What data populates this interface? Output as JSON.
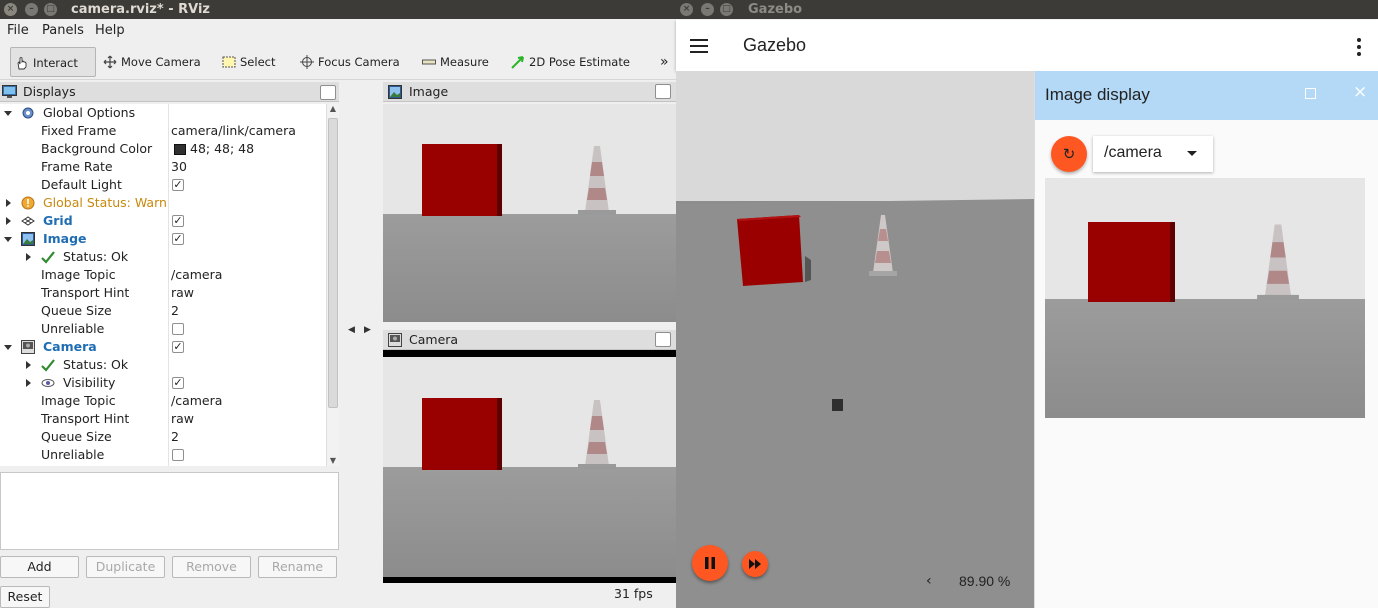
{
  "rviz": {
    "window_title": "camera.rviz* - RViz",
    "menu": [
      "File",
      "Panels",
      "Help"
    ],
    "toolbar": [
      "Interact",
      "Move Camera",
      "Select",
      "Focus Camera",
      "Measure",
      "2D Pose Estimate"
    ],
    "toolbar_overflow": "»",
    "displays_title": "Displays",
    "tree": {
      "global_options": "Global Options",
      "fixed_frame_label": "Fixed Frame",
      "fixed_frame_value": "camera/link/camera",
      "background_color_label": "Background Color",
      "background_color_value": "48; 48; 48",
      "frame_rate_label": "Frame Rate",
      "frame_rate_value": "30",
      "default_light_label": "Default Light",
      "global_status": "Global Status: Warn",
      "grid": "Grid",
      "image": "Image",
      "image_status": "Status: Ok",
      "image_topic_label": "Image Topic",
      "image_topic_value": "/camera",
      "transport_hint_label": "Transport Hint",
      "transport_hint_value": "raw",
      "queue_size_label": "Queue Size",
      "queue_size_value": "2",
      "unreliable_label": "Unreliable",
      "camera": "Camera",
      "camera_status": "Status: Ok",
      "visibility": "Visibility",
      "cam_image_topic_label": "Image Topic",
      "cam_image_topic_value": "/camera",
      "cam_transport_hint_label": "Transport Hint",
      "cam_transport_hint_value": "raw",
      "cam_queue_size_label": "Queue Size",
      "cam_queue_size_value": "2",
      "cam_unreliable_label": "Unreliable"
    },
    "buttons": {
      "add": "Add",
      "duplicate": "Duplicate",
      "remove": "Remove",
      "rename": "Rename",
      "reset": "Reset"
    },
    "image_panel_title": "Image",
    "camera_panel_title": "Camera",
    "fps": "31 fps",
    "colors": {
      "background_swatch": "#303030",
      "status_blue": "#1f6db3",
      "warn": "#c8890e"
    }
  },
  "gazebo": {
    "window_title": "Gazebo",
    "app_title": "Gazebo",
    "image_display_title": "Image display",
    "topic": "/camera",
    "zoom": "89.90 %",
    "colors": {
      "accent": "#ff5722",
      "panel_header": "#b3d9f7"
    }
  }
}
